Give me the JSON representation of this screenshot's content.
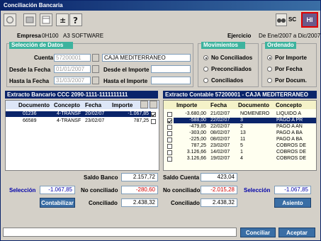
{
  "window": {
    "title": "Conciliación Bancaria"
  },
  "toolbar": {
    "hi_label": "HI",
    "sc_label": "SC"
  },
  "company": {
    "label": "Empresa",
    "code": "0H100",
    "name": "A3 SOFTWARE"
  },
  "exercise": {
    "label": "Ejercicio",
    "value": "De Ene/2007 a Dic/2007"
  },
  "selection": {
    "header": "Selección de Datos",
    "cuenta_label": "Cuenta",
    "cuenta_value": "57200001",
    "cuenta_name": "CAJA MEDITERRANEO",
    "desde_fecha_label": "Desde la Fecha",
    "desde_fecha_value": "01/01/2007",
    "hasta_fecha_label": "Hasta la Fecha",
    "hasta_fecha_value": "31/03/2007",
    "desde_importe_label": "Desde el Importe",
    "hasta_importe_label": "Hasta el Importe"
  },
  "movimientos": {
    "header": "Movimientos",
    "options": [
      "No Conciliados",
      "Preconciliados",
      "Conciliados"
    ],
    "selected": 0
  },
  "ordenado": {
    "header": "Ordenado",
    "options": [
      "Por Importe",
      "Por Fecha",
      "Por Docum."
    ],
    "selected": 0
  },
  "bank": {
    "header": "Extracto Bancario CCC 2090-1111-1111111111",
    "columns": [
      "Documento",
      "Concepto",
      "Fecha",
      "Importe"
    ],
    "rows": [
      {
        "doc": "01236",
        "concepto": "4-TRANSF",
        "fecha": "20/02/07",
        "importe": "-1.067,85",
        "checked": true,
        "selected": true
      },
      {
        "doc": "66589",
        "concepto": "4-TRANSF",
        "fecha": "23/02/07",
        "importe": "787,25",
        "checked": false,
        "selected": false
      }
    ],
    "saldo_label": "Saldo Banco",
    "saldo_value": "2.157,72",
    "seleccion_label": "Selección",
    "seleccion_value": "-1.067,85",
    "noconc_label": "No conciliado",
    "noconc_value": "-280,60",
    "conc_label": "Conciliado",
    "conc_value": "2.438,32",
    "button": "Contabilizar"
  },
  "ledger": {
    "header": "Extracto Contable 57200001 - CAJA MEDITERRANEO",
    "columns": [
      "Importe",
      "Fecha",
      "Documento",
      "Concepto"
    ],
    "rows": [
      {
        "importe": "-3.680,00",
        "fecha": "21/02/07",
        "doc": "NOMENERO",
        "concepto": "LIQUIDO A",
        "checked": false,
        "selected": false
      },
      {
        "importe": "-588,00",
        "fecha": "22/02/07",
        "doc": "3",
        "concepto": "PAGO A PR",
        "checked": true,
        "selected": true
      },
      {
        "importe": "-479,85",
        "fecha": "22/02/07",
        "doc": "2",
        "concepto": "PAGO A AN",
        "checked": false,
        "selected": false
      },
      {
        "importe": "-303,00",
        "fecha": "08/02/07",
        "doc": "13",
        "concepto": "PAGO A BA",
        "checked": false,
        "selected": false
      },
      {
        "importe": "-225,00",
        "fecha": "08/02/07",
        "doc": "11",
        "concepto": "PAGO A BA",
        "checked": false,
        "selected": false
      },
      {
        "importe": "787,25",
        "fecha": "23/02/07",
        "doc": "5",
        "concepto": "COBROS DE",
        "checked": false,
        "selected": false
      },
      {
        "importe": "3.126,66",
        "fecha": "14/02/07",
        "doc": "1",
        "concepto": "COBROS DE",
        "checked": false,
        "selected": false
      },
      {
        "importe": "3.126,66",
        "fecha": "19/02/07",
        "doc": "4",
        "concepto": "COBROS DE",
        "checked": false,
        "selected": false
      }
    ],
    "saldo_label": "Saldo Cuenta",
    "saldo_value": "423,04",
    "noconc_label": "No conciliado",
    "noconc_value": "-2.015,28",
    "conc_label": "Conciliado",
    "conc_value": "2.438,32",
    "seleccion_label": "Selección",
    "seleccion_value": "-1.067,85",
    "button": "Asiento"
  },
  "footer": {
    "conciliar": "Conciliar",
    "aceptar": "Aceptar"
  }
}
